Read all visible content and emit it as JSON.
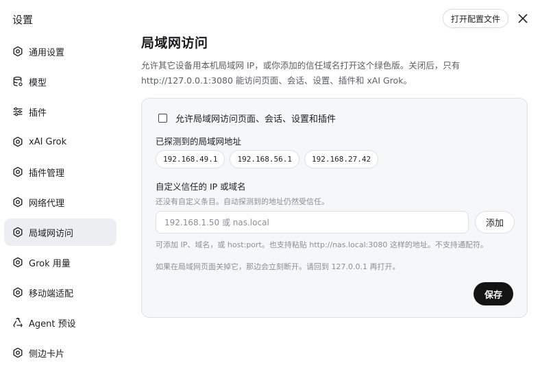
{
  "app": {
    "title": "设置"
  },
  "header": {
    "open_config_label": "打开配置文件"
  },
  "sidebar": {
    "items": [
      {
        "label": "通用设置",
        "icon": "gear-icon"
      },
      {
        "label": "模型",
        "icon": "database-icon"
      },
      {
        "label": "插件",
        "icon": "sliders-icon"
      },
      {
        "label": "xAI Grok",
        "icon": "gear-icon"
      },
      {
        "label": "插件管理",
        "icon": "gear-icon"
      },
      {
        "label": "网络代理",
        "icon": "gear-icon"
      },
      {
        "label": "局域网访问",
        "icon": "gear-icon",
        "active": true
      },
      {
        "label": "Grok 用量",
        "icon": "gear-icon"
      },
      {
        "label": "移动端适配",
        "icon": "gear-icon"
      },
      {
        "label": "Agent 预设",
        "icon": "recycle-icon"
      },
      {
        "label": "侧边卡片",
        "icon": "gear-icon"
      }
    ]
  },
  "main": {
    "title": "局域网访问",
    "description_line1": "允许其它设备用本机局域网 IP，或你添加的信任域名打开这个绿色版。关闭后，只有",
    "description_line2": "http://127.0.0.1:3080 能访问页面、会话、设置、插件和 xAI Grok。"
  },
  "card": {
    "checkbox_label": "允许局域网访问页面、会话、设置和插件",
    "checkbox_checked": false,
    "detected_label": "已探测到的局域网地址",
    "detected_addresses": [
      "192.168.49.1",
      "192.168.56.1",
      "192.168.27.42"
    ],
    "custom_label": "自定义信任的 IP 或域名",
    "custom_empty_hint": "还没有自定义条目。自动探测到的地址仍然受信任。",
    "input_placeholder": "192.168.1.50 或 nas.local",
    "add_label": "添加",
    "format_hint": "可添加 IP、域名，或 host:port。也支持粘贴 http://nas.local:3080 这样的地址。不支持通配符。",
    "warning_hint": "如果在局域网页面关掉它，那边会立刻断开。请回到 127.0.0.1 再打开。",
    "save_label": "保存"
  }
}
